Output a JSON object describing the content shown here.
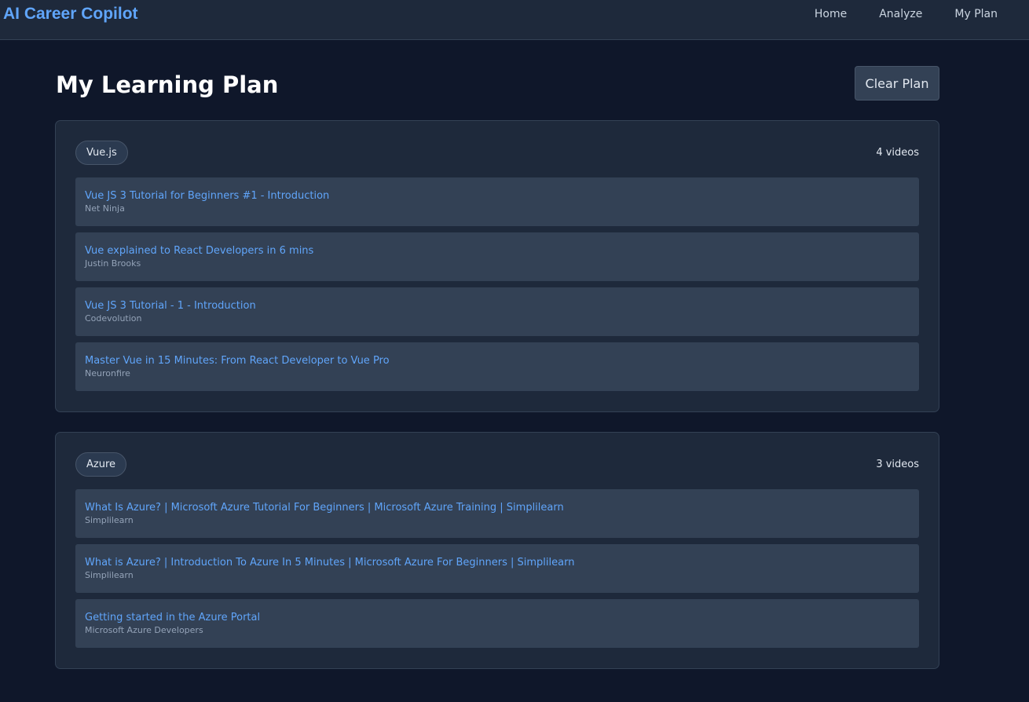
{
  "nav": {
    "brand": "AI Career Copilot",
    "links": [
      "Home",
      "Analyze",
      "My Plan"
    ]
  },
  "page": {
    "title": "My Learning Plan",
    "clear_label": "Clear Plan"
  },
  "sections": [
    {
      "tag": "Vue.js",
      "count": "4 videos",
      "videos": [
        {
          "title": "Vue JS 3 Tutorial for Beginners #1 - Introduction",
          "channel": "Net Ninja"
        },
        {
          "title": "Vue explained to React Developers in 6 mins",
          "channel": "Justin Brooks"
        },
        {
          "title": "Vue JS 3 Tutorial - 1 - Introduction",
          "channel": "Codevolution"
        },
        {
          "title": "Master Vue in 15 Minutes: From React Developer to Vue Pro",
          "channel": "Neuronfire"
        }
      ]
    },
    {
      "tag": "Azure",
      "count": "3 videos",
      "videos": [
        {
          "title": "What Is Azure? | Microsoft Azure Tutorial For Beginners | Microsoft Azure Training | Simplilearn",
          "channel": "Simplilearn"
        },
        {
          "title": "What is Azure? | Introduction To Azure In 5 Minutes | Microsoft Azure For Beginners | Simplilearn",
          "channel": "Simplilearn"
        },
        {
          "title": "Getting started in the Azure Portal",
          "channel": "Microsoft Azure Developers"
        }
      ]
    }
  ],
  "colors": {
    "background": "#0f172a",
    "panel": "#1e293b",
    "card": "#334155",
    "accent": "#60a5fa"
  }
}
